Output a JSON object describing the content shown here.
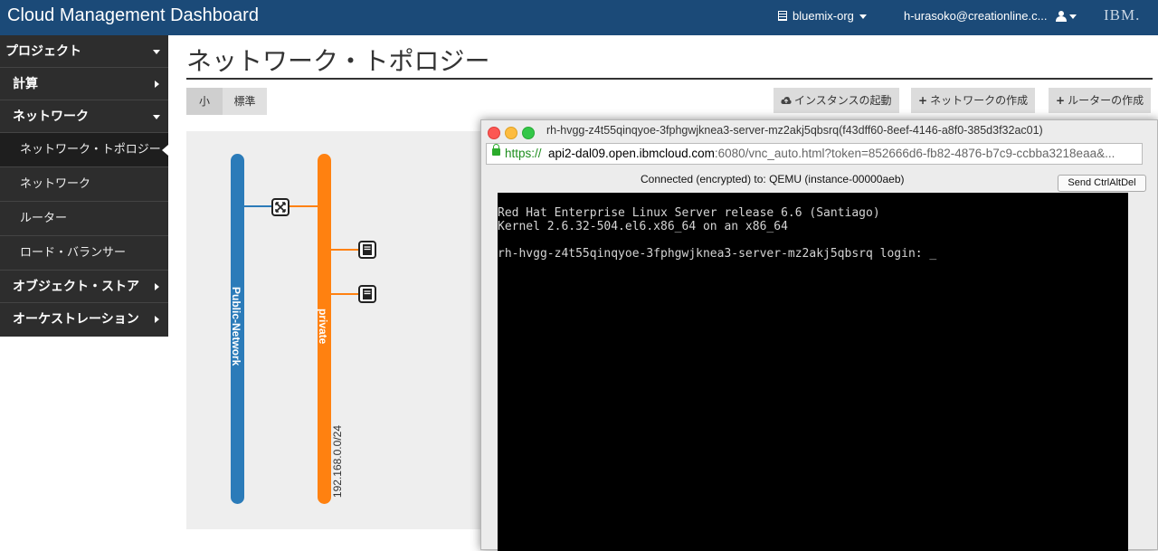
{
  "header": {
    "app_title": "Cloud Management Dashboard",
    "org": "bluemix-org",
    "user": "h-urasoko@creationline.c...",
    "logo": "IBM.",
    "bar_color": "#1b4a78"
  },
  "sidebar": {
    "items": [
      {
        "label": "プロジェクト",
        "expanded": true
      },
      {
        "label": "計算"
      },
      {
        "label": "ネットワーク",
        "expanded": true
      },
      {
        "label": "ネットワーク・トポロジー",
        "active": true
      },
      {
        "label": "ネットワーク"
      },
      {
        "label": "ルーター"
      },
      {
        "label": "ロード・バランサー"
      },
      {
        "label": "オブジェクト・ストア"
      },
      {
        "label": "オーケストレーション"
      }
    ]
  },
  "main": {
    "title": "ネットワーク・トポロジー",
    "size_buttons": [
      "小",
      "標準"
    ],
    "actions": [
      "インスタンスの起動",
      "ネットワークの作成",
      "ルーターの作成"
    ]
  },
  "topology": {
    "networks": [
      {
        "name": "Public-Network",
        "color": "#2b7bb9"
      },
      {
        "name": "private",
        "color": "#ff8110",
        "cidr": "192.168.0.0/24"
      }
    ],
    "icons": [
      "router-icon",
      "instance-icon",
      "instance-icon"
    ]
  },
  "vnc_window": {
    "title": "rh-hvgg-z4t55qinqyoe-3fphgwjknea3-server-mz2akj5qbsrq(f43dff60-8eef-4146-a8f0-385d3f32ac01)",
    "url_scheme": "https://",
    "url_host": "api2-dal09.open.ibmcloud.com",
    "url_path": ":6080/vnc_auto.html?token=852666d6-fb82-4876-b7c9-ccbba3218eaa&...",
    "status": "Connected (encrypted) to: QEMU (instance-00000aeb)",
    "send_button": "Send CtrlAltDel",
    "console_line1": "Red Hat Enterprise Linux Server release 6.6 (Santiago)",
    "console_line2": "Kernel 2.6.32-504.el6.x86_64 on an x86_64",
    "console_line3": "",
    "console_line4": "rh-hvgg-z4t55qinqyoe-3fphgwjknea3-server-mz2akj5qbsrq login: _"
  }
}
